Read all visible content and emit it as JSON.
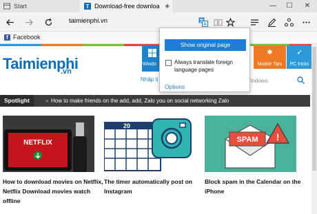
{
  "browser": {
    "tabs": [
      {
        "label": "Start",
        "close": "×"
      },
      {
        "label": "Download-free downloa",
        "close": "×"
      }
    ],
    "new_tab": "+",
    "window_controls": {
      "minimize": "—",
      "maximize": "☐",
      "close": "✕"
    },
    "address": "taimienphi.vn",
    "favorites": [
      {
        "label": "Facebook",
        "icon": "f"
      }
    ]
  },
  "translate_popup": {
    "show_original": "Show original page",
    "always_translate": "Always translate foreign language pages",
    "options": "Options"
  },
  "site": {
    "logo": "Taimienphi",
    "logo_suffix": ".vn",
    "nav": {
      "windows": "Windo",
      "mobile": "Mobile Tips",
      "pc": "PC tricks"
    },
    "nhap": "Nhập tị",
    "search_placeholder": "Windows",
    "spotlight_label": "Spotlight",
    "spotlight_text": "How to make friends on the add, add, Zalo you on social networking Zalo",
    "articles": [
      {
        "title": "How to download movies on Netflix, Netflix Download movies watch offline",
        "image_text": "NETFLIX"
      },
      {
        "title": "The timer automatically post on Instagram",
        "image_text": "20"
      },
      {
        "title": "Block spam in the Calendar on the iPhone",
        "image_text": "SPAM"
      }
    ]
  },
  "colors": {
    "accent_blue": "#1e7ed3",
    "logo_blue": "#0a6fb6",
    "netflix_red": "#e50914",
    "mobile_orange": "#f07a24",
    "spotlight_bg": "#3c3c3c"
  }
}
